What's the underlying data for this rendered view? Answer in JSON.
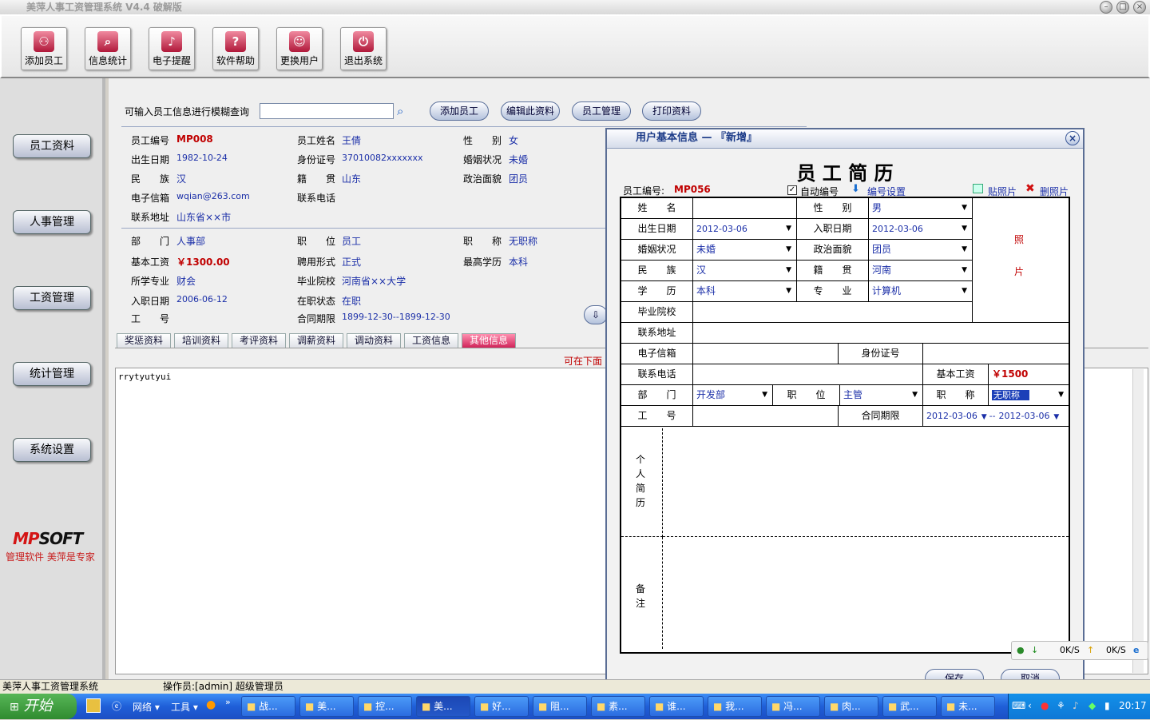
{
  "window": {
    "title": "美萍人事工资管理系统 V4.4 破解版"
  },
  "toolbar": {
    "buttons": [
      {
        "label": "添加员工",
        "icon": "person-icon"
      },
      {
        "label": "信息统计",
        "icon": "magnifier-icon"
      },
      {
        "label": "电子提醒",
        "icon": "speaker-icon"
      },
      {
        "label": "软件帮助",
        "icon": "help-icon"
      },
      {
        "label": "更换用户",
        "icon": "users-icon"
      },
      {
        "label": "退出系统",
        "icon": "power-icon"
      }
    ]
  },
  "sidebar": {
    "items": [
      "员工资料",
      "人事管理",
      "工资管理",
      "统计管理",
      "系统设置"
    ],
    "logo": "MPSOFT",
    "slogan": "管理软件 美萍是专家"
  },
  "search": {
    "label": "可输入员工信息进行模糊查询",
    "value": "",
    "buttons": [
      "添加员工",
      "编辑此资料",
      "员工管理",
      "打印资料"
    ]
  },
  "employee": {
    "rows": [
      [
        {
          "k": "员工编号",
          "v": "MP008",
          "red": true
        },
        {
          "k": "员工姓名",
          "v": "王倩"
        },
        {
          "k": "性　　别",
          "v": "女"
        }
      ],
      [
        {
          "k": "出生日期",
          "v": "1982-10-24"
        },
        {
          "k": "身份证号",
          "v": "37010082xxxxxxx"
        },
        {
          "k": "婚姻状况",
          "v": "未婚"
        }
      ],
      [
        {
          "k": "民　　族",
          "v": "汉"
        },
        {
          "k": "籍　　贯",
          "v": "山东"
        },
        {
          "k": "政治面貌",
          "v": "团员"
        }
      ],
      [
        {
          "k": "电子信箱",
          "v": "wqian@263.com"
        },
        {
          "k": "联系电话",
          "v": ""
        }
      ],
      [
        {
          "k": "联系地址",
          "v": "山东省××市"
        }
      ],
      [
        {
          "k": "部　　门",
          "v": "人事部"
        },
        {
          "k": "职　　位",
          "v": "员工"
        },
        {
          "k": "职　　称",
          "v": "无职称"
        }
      ],
      [
        {
          "k": "基本工资",
          "v": "￥1300.00",
          "red": true
        },
        {
          "k": "聘用形式",
          "v": "正式"
        },
        {
          "k": "最高学历",
          "v": "本科"
        }
      ],
      [
        {
          "k": "所学专业",
          "v": "财会"
        },
        {
          "k": "毕业院校",
          "v": "河南省××大学"
        }
      ],
      [
        {
          "k": "入职日期",
          "v": "2006-06-12"
        },
        {
          "k": "在职状态",
          "v": "在职"
        }
      ],
      [
        {
          "k": "工　　号",
          "v": ""
        },
        {
          "k": "合同期限",
          "v": "1899-12-30--1899-12-30"
        }
      ]
    ]
  },
  "tabs": [
    "奖惩资料",
    "培训资料",
    "考评资料",
    "调薪资料",
    "调动资料",
    "工资信息",
    "其他信息"
  ],
  "active_tab": "其他信息",
  "hint": "可在下面",
  "notes_text": "rrytyutyui",
  "status": {
    "app": "美萍人事工资管理系统",
    "operator": "操作员:[admin] 超级管理员"
  },
  "dialog": {
    "title": "用户基本信息 — 『新增』",
    "heading": "员 工 简 历",
    "id_label": "员工编号:",
    "id_value": "MP056",
    "auto_id": "自动编号",
    "id_settings": "编号设置",
    "paste_photo": "贴照片",
    "delete_photo": "删照片",
    "photo_1": "照",
    "photo_2": "片",
    "f": {
      "name": "姓　　名",
      "gender": "性　　别",
      "gender_v": "男",
      "birth": "出生日期",
      "birth_v": "2012-03-06",
      "hire": "入职日期",
      "hire_v": "2012-03-06",
      "marital": "婚姻状况",
      "marital_v": "未婚",
      "political": "政治面貌",
      "political_v": "团员",
      "ethnic": "民　　族",
      "ethnic_v": "汉",
      "native": "籍　　贯",
      "native_v": "河南",
      "edu": "学　　历",
      "edu_v": "本科",
      "major": "专　　业",
      "major_v": "计算机",
      "school": "毕业院校",
      "address": "联系地址",
      "email": "电子信箱",
      "idcard": "身份证号",
      "phone": "联系电话",
      "salary": "基本工资",
      "salary_v": "￥1500",
      "dept": "部　　门",
      "dept_v": "开发部",
      "position": "职　　位",
      "position_v": "主管",
      "title": "职　　称",
      "title_v": "无职称",
      "jobno": "工　　号",
      "contract": "合同期限",
      "contract_from": "2012-03-06",
      "contract_sep": "--",
      "contract_to": "2012-03-06",
      "resume_1": "个",
      "resume_2": "人",
      "resume_3": "简",
      "resume_4": "历",
      "remark_1": "备",
      "remark_2": "注"
    },
    "save": "保存",
    "cancel": "取消"
  },
  "netspeed": {
    "down": "0K/S",
    "up": "0K/S"
  },
  "taskbar": {
    "start": "开始",
    "quick": [
      "网络",
      "工具"
    ],
    "tasks": [
      "战...",
      "美...",
      "控...",
      "美...",
      "好...",
      "阻...",
      "素...",
      "谁...",
      "我...",
      "冯...",
      "肉...",
      "武...",
      "未..."
    ],
    "clock": "20:17"
  }
}
